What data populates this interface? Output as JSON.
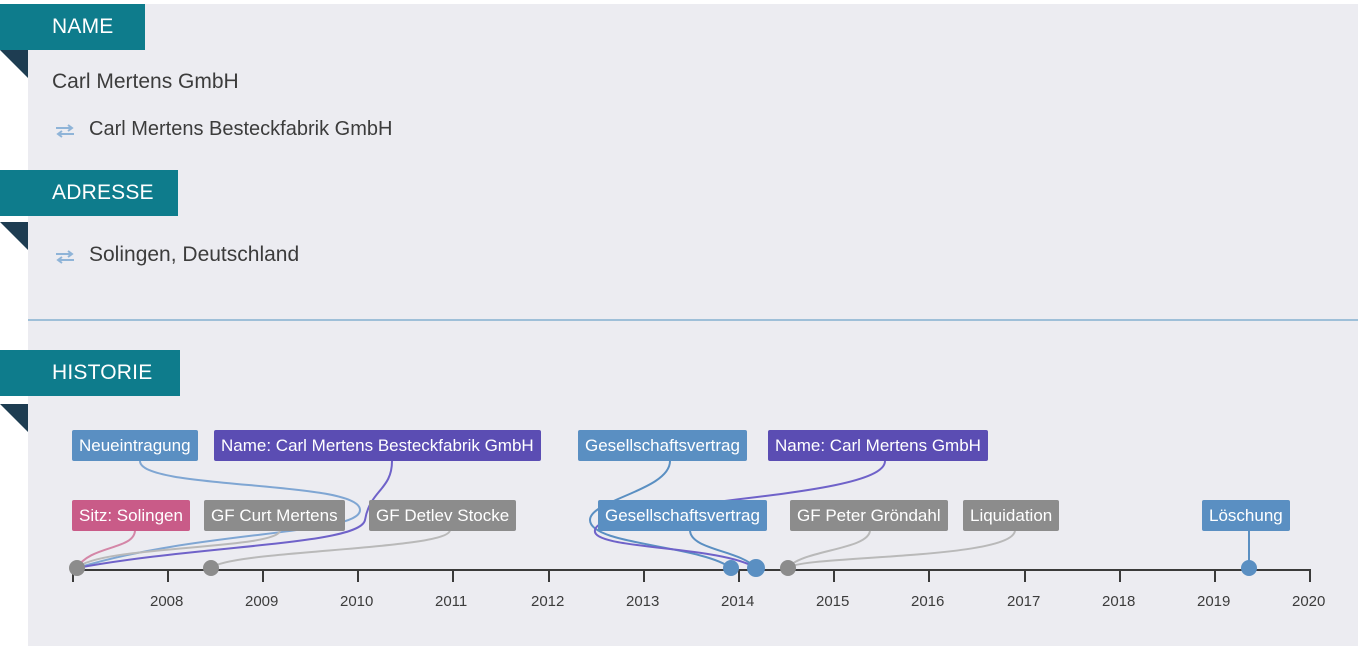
{
  "sections": {
    "name": {
      "title": "NAME",
      "current": "Carl Mertens GmbH",
      "previous": "Carl Mertens Besteckfabrik GmbH"
    },
    "address": {
      "title": "ADRESSE",
      "value": "Solingen, Deutschland"
    },
    "history": {
      "title": "HISTORIE"
    }
  },
  "icons": {
    "swap": "swap-arrows-icon"
  },
  "colors": {
    "banner": "#0e7c8c",
    "fold": "#1e3d52",
    "blue": "#5a8fc2",
    "purple": "#5b4db3",
    "pink": "#c95b88",
    "gray": "#8c8c8c",
    "axis": "#3a3a3a"
  },
  "timeline": {
    "years": [
      "2008",
      "2009",
      "2010",
      "2011",
      "2012",
      "2013",
      "2014",
      "2015",
      "2016",
      "2017",
      "2018",
      "2019",
      "2020"
    ],
    "events": [
      {
        "label": "Neueintragung",
        "color": "blue"
      },
      {
        "label": "Name: Carl Mertens Besteckfabrik GmbH",
        "color": "purple"
      },
      {
        "label": "Gesellschaftsvertrag",
        "color": "blue"
      },
      {
        "label": "Name: Carl Mertens GmbH",
        "color": "purple"
      },
      {
        "label": "Sitz: Solingen",
        "color": "pink"
      },
      {
        "label": "GF Curt Mertens",
        "color": "gray"
      },
      {
        "label": "GF Detlev Stocke",
        "color": "gray"
      },
      {
        "label": "Gesellschaftsvertrag",
        "color": "blue"
      },
      {
        "label": "GF Peter Gröndahl",
        "color": "gray"
      },
      {
        "label": "Liquidation",
        "color": "gray"
      },
      {
        "label": "Löschung",
        "color": "blue"
      }
    ]
  }
}
